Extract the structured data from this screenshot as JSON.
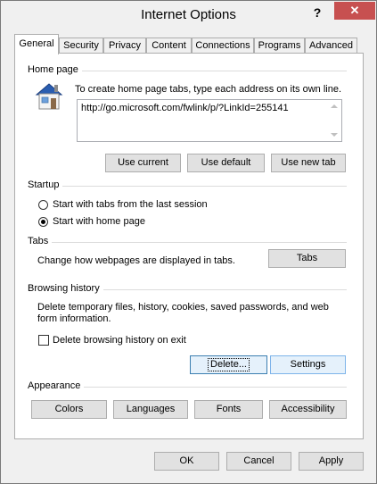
{
  "window": {
    "title": "Internet Options",
    "help_symbol": "?",
    "close_symbol": "✕"
  },
  "tabs": [
    {
      "label": "General",
      "active": true
    },
    {
      "label": "Security"
    },
    {
      "label": "Privacy"
    },
    {
      "label": "Content"
    },
    {
      "label": "Connections"
    },
    {
      "label": "Programs"
    },
    {
      "label": "Advanced"
    }
  ],
  "home_page": {
    "section_label": "Home page",
    "description": "To create home page tabs, type each address on its own line.",
    "url_value": "http://go.microsoft.com/fwlink/p/?LinkId=255141",
    "buttons": {
      "use_current": "Use current",
      "use_default": "Use default",
      "use_new_tab": "Use new tab"
    }
  },
  "startup": {
    "section_label": "Startup",
    "option_last_session": "Start with tabs from the last session",
    "option_home_page": "Start with home page"
  },
  "tabs_section": {
    "section_label": "Tabs",
    "description": "Change how webpages are displayed in tabs.",
    "button": "Tabs"
  },
  "browsing_history": {
    "section_label": "Browsing history",
    "description_line1": "Delete temporary files, history, cookies, saved passwords, and web",
    "description_line2": "form information.",
    "checkbox_label": "Delete browsing history on exit",
    "delete_button": "Delete...",
    "settings_button": "Settings"
  },
  "appearance": {
    "section_label": "Appearance",
    "colors": "Colors",
    "languages": "Languages",
    "fonts": "Fonts",
    "accessibility": "Accessibility"
  },
  "footer": {
    "ok": "OK",
    "cancel": "Cancel",
    "apply": "Apply"
  }
}
